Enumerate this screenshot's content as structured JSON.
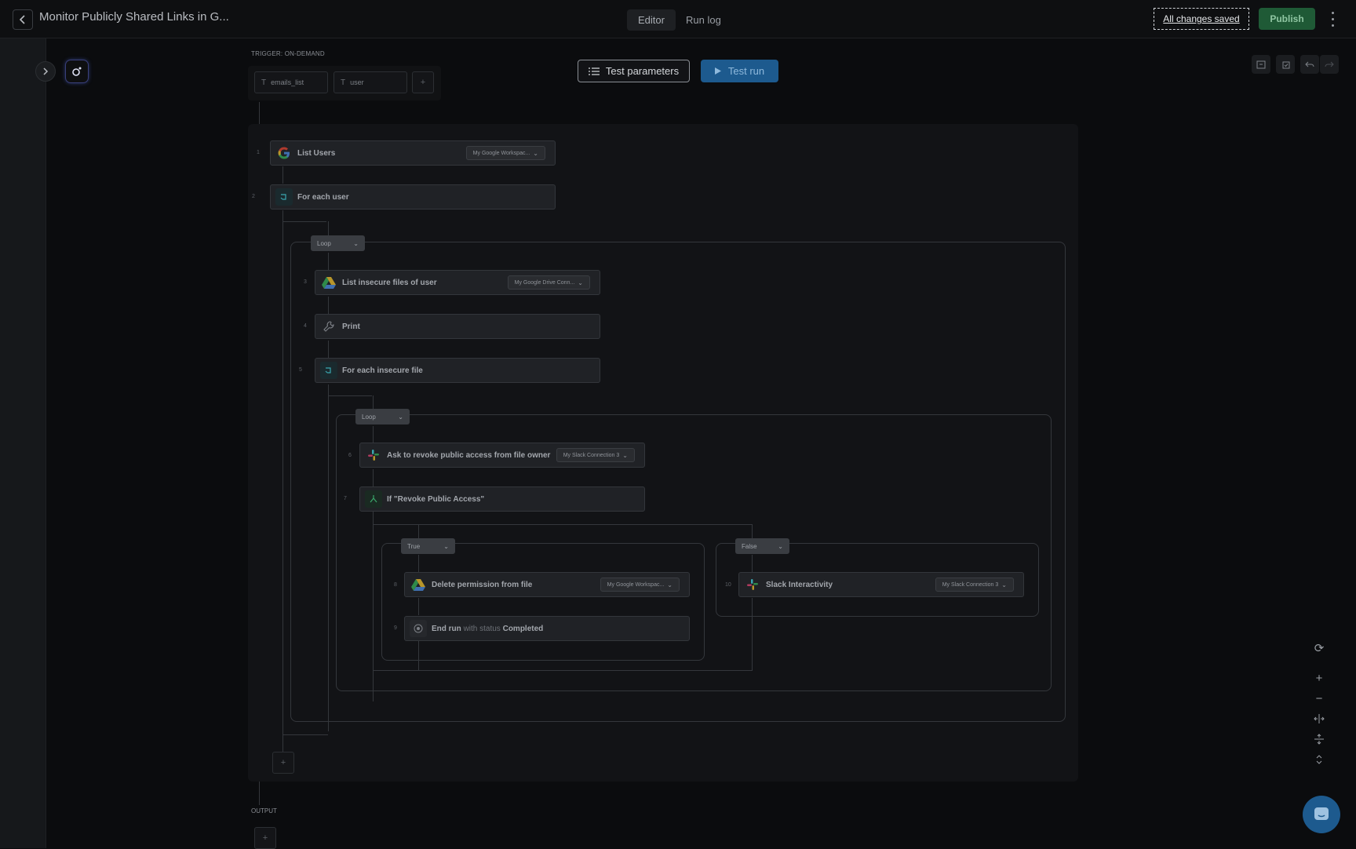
{
  "header": {
    "title": "Monitor Publicly Shared Links in G...",
    "tabs": [
      {
        "label": "Editor",
        "active": true
      },
      {
        "label": "Run log",
        "active": false
      }
    ],
    "save_status": "All changes saved",
    "publish_label": "Publish"
  },
  "trigger": {
    "label": "TRIGGER: ON-DEMAND",
    "params": [
      "emails_list",
      "user"
    ],
    "add_symbol": "+"
  },
  "toolbar": {
    "test_parameters_label": "Test parameters",
    "test_run_label": "Test run"
  },
  "steps": {
    "s1": {
      "num": "1",
      "label": "List Users",
      "connection": "My Google Workspac..."
    },
    "s2": {
      "num": "2",
      "label": "For each user"
    },
    "loop1": {
      "label": "Loop"
    },
    "s3": {
      "num": "3",
      "label": "List insecure files of user",
      "connection": "My Google Drive Conn..."
    },
    "s4": {
      "num": "4",
      "label": "Print"
    },
    "s5": {
      "num": "5",
      "label": "For each insecure file"
    },
    "loop2": {
      "label": "Loop"
    },
    "s6": {
      "num": "6",
      "label": "Ask to revoke public access from file owner",
      "connection": "My Slack Connection 3"
    },
    "s7": {
      "num": "7",
      "label": "If \"Revoke Public Access\""
    },
    "branch_true": {
      "label": "True"
    },
    "branch_false": {
      "label": "False"
    },
    "s8": {
      "num": "8",
      "label": "Delete permission from file",
      "connection": "My Google Workspac..."
    },
    "s9": {
      "num": "9",
      "label": "End run",
      "status_prefix": "with status",
      "status_value": "Completed"
    },
    "s10": {
      "num": "10",
      "label": "Slack Interactivity",
      "connection": "My Slack Connection 3"
    }
  },
  "workflow_add_symbol": "+",
  "output": {
    "label": "OUTPUT",
    "add_symbol": "+"
  },
  "zoom_controls": [
    "reset",
    "zoom-in",
    "zoom-out",
    "fit-horizontal",
    "fit-vertical",
    "collapse"
  ],
  "colors": {
    "accent_blue": "#1d5a8e",
    "publish_green": "#1f5a36",
    "background": "#0b0c0e"
  }
}
